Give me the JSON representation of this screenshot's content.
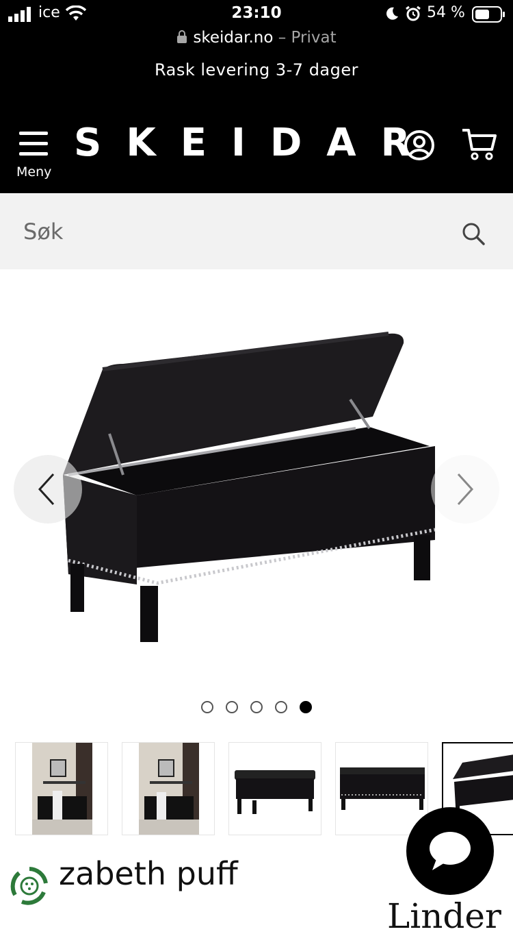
{
  "status": {
    "carrier": "ice",
    "time": "23:10",
    "battery": "54 %"
  },
  "browser": {
    "domain": "skeidar.no",
    "separator": " – ",
    "mode": "Privat"
  },
  "promo": "Rask levering 3-7 dager",
  "header": {
    "logo": "SKEIDAR",
    "menu_label": "Meny"
  },
  "search": {
    "placeholder": "Søk"
  },
  "carousel": {
    "slide_count": 5,
    "active_slide": 5
  },
  "product": {
    "title_visible": "zabeth puff",
    "partial_brand": "Linder"
  },
  "colors": {
    "header_bg": "#000000",
    "search_bg": "#f2f2f2",
    "accent": "#000000"
  }
}
